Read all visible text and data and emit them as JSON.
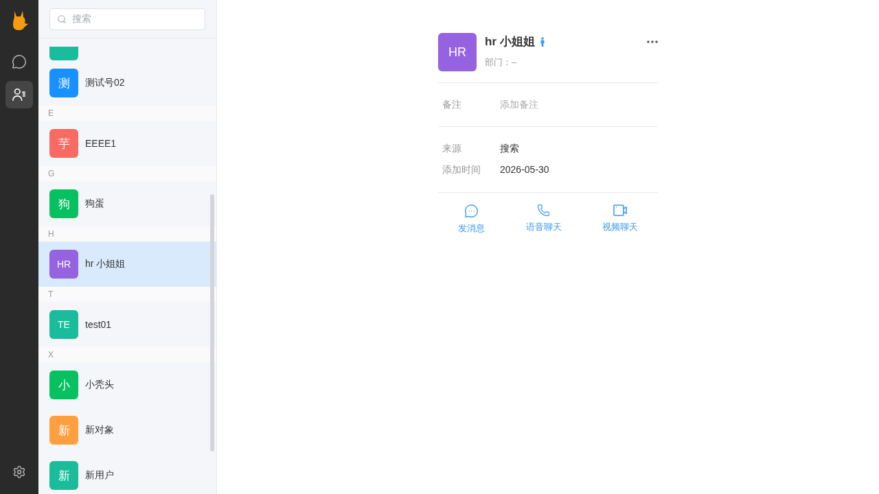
{
  "nav": [
    {
      "kind": "chat",
      "selected": false
    },
    {
      "kind": "contacts",
      "selected": true
    }
  ],
  "search": {
    "placeholder": "搜索"
  },
  "partial_row": {
    "color": "#1abc9c"
  },
  "groups": [
    {
      "contacts": [
        {
          "avatar": "测",
          "name": "测试号02",
          "color": "#1890ff",
          "selected": false
        }
      ]
    },
    {
      "letter": "E",
      "contacts": [
        {
          "avatar": "芋",
          "name": "EEEE1",
          "color": "#f86b63",
          "selected": false
        }
      ]
    },
    {
      "letter": "G",
      "contacts": [
        {
          "avatar": "狗",
          "name": "狗蛋",
          "color": "#07c160",
          "selected": false
        }
      ]
    },
    {
      "letter": "H",
      "contacts": [
        {
          "avatar": "HR",
          "name": "hr 小姐姐",
          "color": "#9562e0",
          "selected": true
        }
      ]
    },
    {
      "letter": "T",
      "contacts": [
        {
          "avatar": "TE",
          "name": "test01",
          "color": "#1abc9c",
          "selected": false
        }
      ]
    },
    {
      "letter": "X",
      "contacts": [
        {
          "avatar": "小",
          "name": "小秃头",
          "color": "#07c160",
          "selected": false
        },
        {
          "avatar": "新",
          "name": "新对象",
          "color": "#ff9f40",
          "selected": false
        },
        {
          "avatar": "新",
          "name": "新用户",
          "color": "#1abc9c",
          "selected": false
        }
      ]
    }
  ],
  "profile": {
    "avatar": "HR",
    "color": "#9562e0",
    "name": "hr 小姐姐",
    "gender_badge": {
      "kind": "male"
    },
    "department": "部门：–",
    "remark": {
      "label": "备注",
      "placeholder": "添加备注"
    },
    "fields": [
      {
        "label": "来源",
        "value": "搜索"
      },
      {
        "label": "添加时间",
        "value": "2026-05-30"
      }
    ],
    "actions": [
      {
        "kind": "message",
        "label": "发消息"
      },
      {
        "kind": "voice",
        "label": "语音聊天"
      },
      {
        "kind": "video",
        "label": "视频聊天"
      }
    ]
  }
}
